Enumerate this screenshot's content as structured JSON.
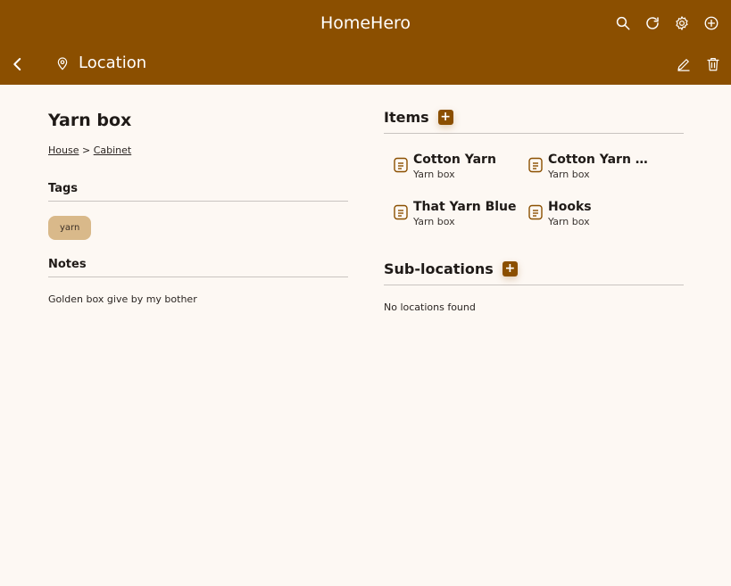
{
  "app": {
    "title": "HomeHero"
  },
  "page": {
    "title": "Location"
  },
  "location": {
    "name": "Yarn box",
    "breadcrumb": [
      {
        "label": "House"
      },
      {
        "label": "Cabinet"
      }
    ],
    "breadcrumb_separator": ">"
  },
  "tags": {
    "heading": "Tags",
    "items": [
      "yarn"
    ]
  },
  "notes": {
    "heading": "Notes",
    "text": "Golden box give by my bother"
  },
  "items": {
    "heading": "Items",
    "add_label": "+",
    "list": [
      {
        "name": "Cotton Yarn",
        "location": "Yarn box"
      },
      {
        "name": "Cotton Yarn …",
        "location": "Yarn box"
      },
      {
        "name": "That Yarn Blue",
        "location": "Yarn box"
      },
      {
        "name": "Hooks",
        "location": "Yarn box"
      }
    ]
  },
  "sublocations": {
    "heading": "Sub-locations",
    "add_label": "+",
    "empty_text": "No locations found"
  },
  "theme": {
    "primary": "#8b4f00",
    "background": "#fdf8f3",
    "tag_bg": "#d9b98a"
  }
}
